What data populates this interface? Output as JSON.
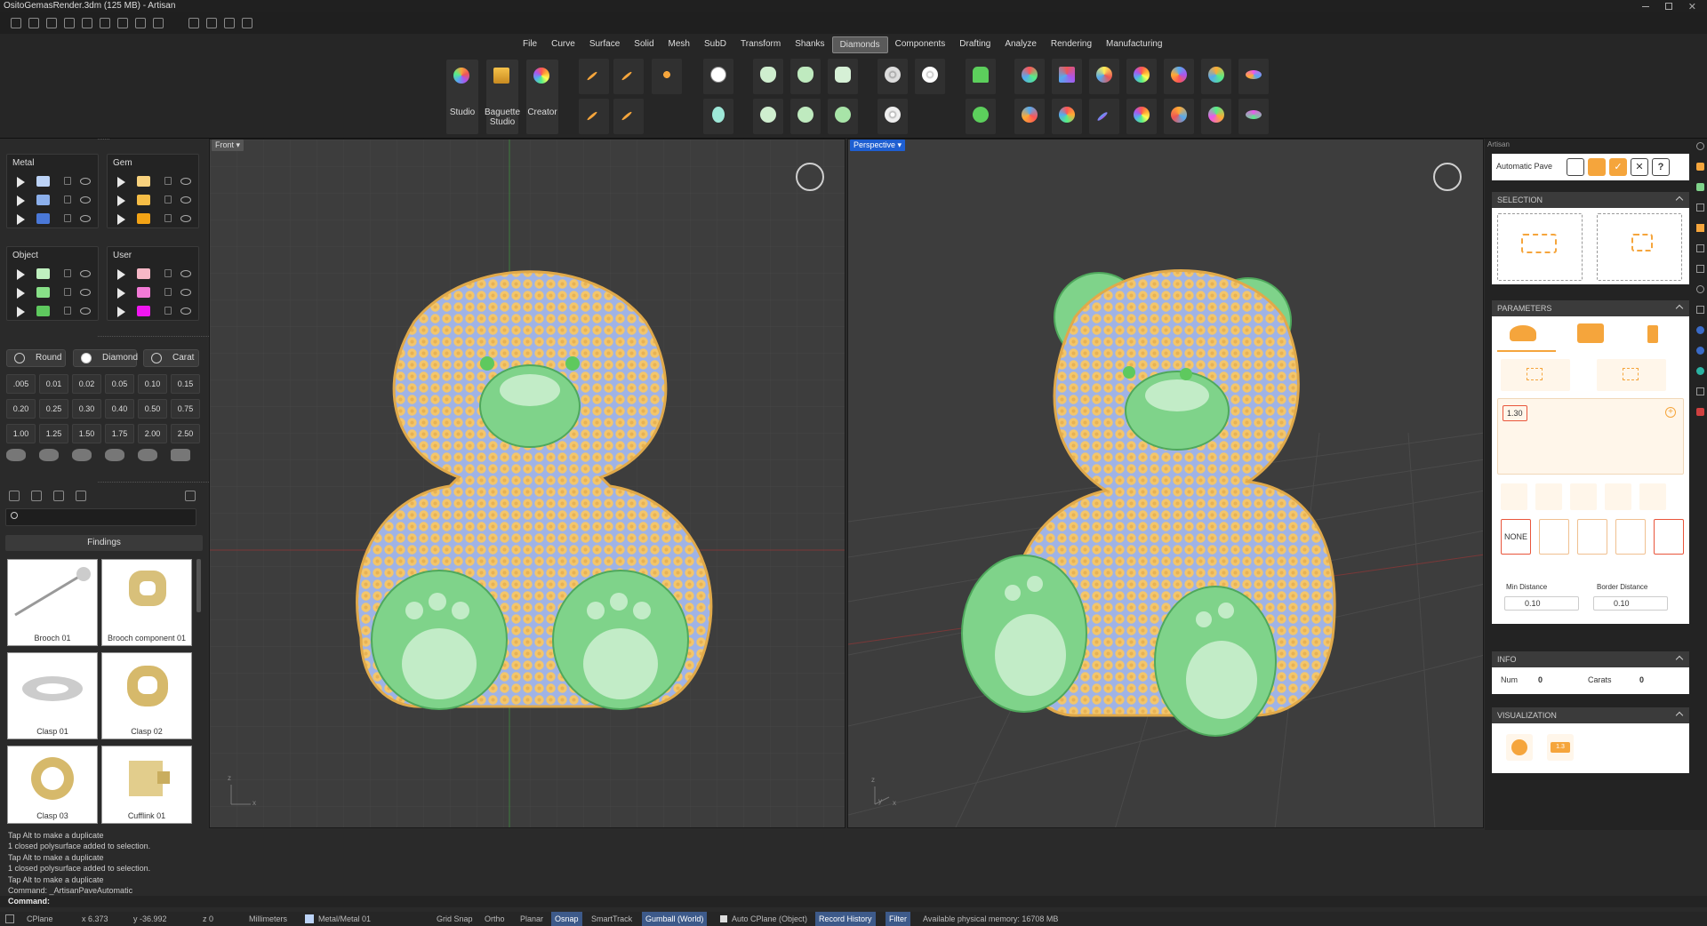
{
  "window": {
    "title": "OsitoGemasRender.3dm (125 MB) - Artisan"
  },
  "menu": {
    "tabs": [
      "File",
      "Curve",
      "Surface",
      "Solid",
      "Mesh",
      "SubD",
      "Transform",
      "Shanks",
      "Diamonds",
      "Components",
      "Drafting",
      "Analyze",
      "Rendering",
      "Manufacturing"
    ],
    "active": "Diamonds"
  },
  "ribbon": {
    "studio": "Studio",
    "baguette": "Baguette Studio",
    "creator": "Creator"
  },
  "layers": {
    "metal": {
      "title": "Metal",
      "colors": [
        "#bcd3f7",
        "#8cb0ec",
        "#4a78d8"
      ]
    },
    "gem": {
      "title": "Gem",
      "colors": [
        "#f8d27e",
        "#f6bd46",
        "#f3a315"
      ]
    },
    "object": {
      "title": "Object",
      "colors": [
        "#bff0bf",
        "#88e088",
        "#5ec95e"
      ]
    },
    "user": {
      "title": "User",
      "colors": [
        "#f6b7c6",
        "#f27ad6",
        "#f016f0"
      ]
    }
  },
  "gemfilters": {
    "shape": "Round",
    "type": "Diamond",
    "unit": "Carat"
  },
  "sizes": [
    ".005",
    "0.01",
    "0.02",
    "0.05",
    "0.10",
    "0.15",
    "0.20",
    "0.25",
    "0.30",
    "0.40",
    "0.50",
    "0.75",
    "1.00",
    "1.25",
    "1.50",
    "1.75",
    "2.00",
    "2.50"
  ],
  "library": {
    "category": "Findings",
    "items": [
      "Brooch 01",
      "Brooch component 01",
      "Clasp 01",
      "Clasp 02",
      "Clasp 03",
      "Cufflink 01"
    ]
  },
  "viewports": {
    "front": "Front",
    "perspective": "Perspective",
    "axis_x": "x",
    "axis_y": "y",
    "axis_z": "z"
  },
  "artisan": {
    "header": "Artisan",
    "tool": "Automatic Pave",
    "sections": {
      "selection": "SELECTION",
      "parameters": "PARAMETERS",
      "info": "INFO",
      "visualization": "VISUALIZATION"
    },
    "size_value": "1.30",
    "none_label": "NONE",
    "min_distance_label": "Min Distance",
    "min_distance": "0.10",
    "border_distance_label": "Border Distance",
    "border_distance": "0.10",
    "num_label": "Num",
    "num": "0",
    "carats_label": "Carats",
    "carats": "0",
    "vis_badge": "1.3",
    "help": "?"
  },
  "command": {
    "history": [
      "Tap Alt to make a duplicate",
      "1 closed polysurface added to selection.",
      "Tap Alt to make a duplicate",
      "1 closed polysurface added to selection.",
      "Tap Alt to make a duplicate",
      "Command: _ArtisanPaveAutomatic"
    ],
    "prompt": "Command:"
  },
  "status": {
    "cplane": "CPlane",
    "x": "x 6.373",
    "y": "y -36.992",
    "z": "z 0",
    "units": "Millimeters",
    "layer": "Metal/Metal 01",
    "gridsnap": "Grid Snap",
    "ortho": "Ortho",
    "planar": "Planar",
    "osnap": "Osnap",
    "smarttrack": "SmartTrack",
    "gumball": "Gumball (World)",
    "autocplane": "Auto CPlane (Object)",
    "recordhistory": "Record History",
    "filter": "Filter",
    "memory": "Available physical memory: 16708 MB"
  },
  "colors": {
    "accent": "#f5a53c",
    "gem_yellow": "#f3c66b",
    "metal_blue": "#9fb3e6",
    "green": "#7fd38a"
  }
}
